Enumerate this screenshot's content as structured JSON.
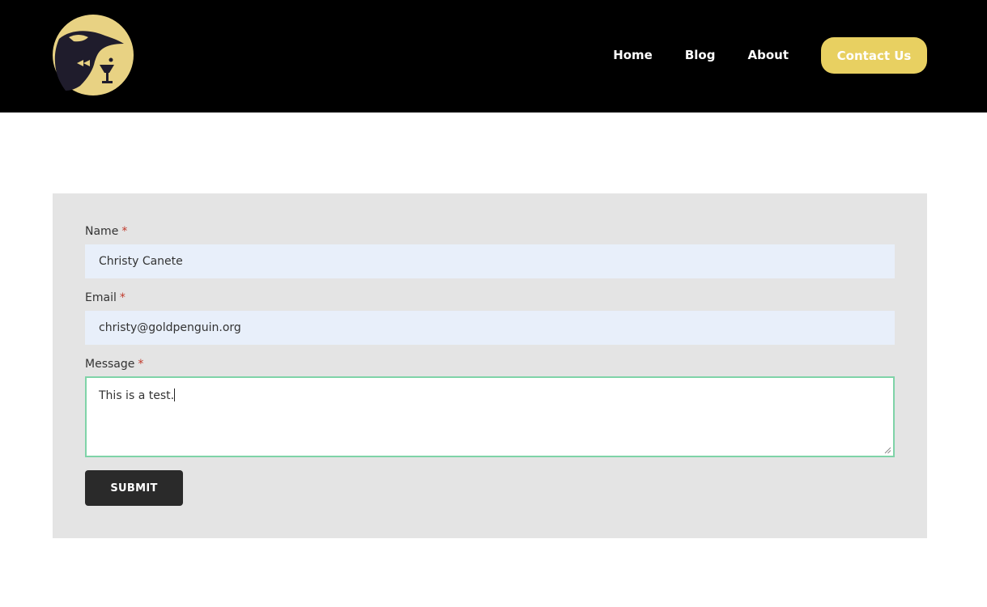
{
  "nav": {
    "home": "Home",
    "blog": "Blog",
    "about": "About",
    "contact": "Contact Us"
  },
  "form": {
    "name_label": "Name",
    "name_value": "Christy Canete",
    "email_label": "Email",
    "email_value": "christy@goldpenguin.org",
    "message_label": "Message",
    "message_value": "This is a test.",
    "required_marker": "*",
    "submit_label": "SUBMIT"
  },
  "colors": {
    "header_bg": "#000000",
    "accent": "#e8d061",
    "panel_bg": "#e4e4e4",
    "input_bg": "#e8effa",
    "focus_border": "#7fd3a8",
    "submit_bg": "#2a2a2a"
  },
  "icons": {
    "logo": "penguin-logo-icon",
    "resize": "resize-grip-icon"
  }
}
